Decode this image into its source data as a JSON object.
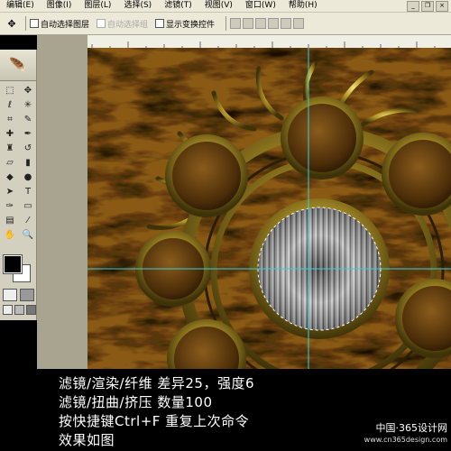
{
  "menu": {
    "items": [
      "编辑(E)",
      "图像(I)",
      "图层(L)",
      "选择(S)",
      "滤镜(T)",
      "视图(V)",
      "窗口(W)",
      "帮助(H)"
    ]
  },
  "options": {
    "auto_select_layer": "自动选择图层",
    "auto_select_group": "自动选择组",
    "show_transform": "显示变换控件"
  },
  "caption": {
    "line1": "滤镜/渲染/纤维 差异25，强度6",
    "line2": "滤镜/扭曲/挤压 数量100",
    "line3": "按快捷键Ctrl+F 重复上次命令",
    "line4": "效果如图"
  },
  "watermark": {
    "title": "中国·365设计网",
    "url": "www.cn365design.com"
  },
  "colors": {
    "foreground": "#000000",
    "background": "#ffffff",
    "gold": "#b8a030",
    "rust": "#8a5a14"
  }
}
